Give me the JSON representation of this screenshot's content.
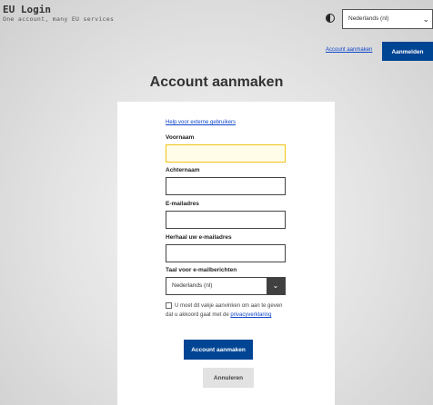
{
  "header": {
    "title": "EU Login",
    "subtitle": "One account, many EU services",
    "contrast_icon": "contrast-icon",
    "language": "Nederlands (nl)",
    "create_account_link": "Account aanmaken",
    "sign_in_button": "Aanmelden"
  },
  "main": {
    "title": "Account aanmaken",
    "help_link": "Help voor externe gebruikers",
    "fields": {
      "first_name_label": "Voornaam",
      "first_name_value": "",
      "last_name_label": "Achternaam",
      "last_name_value": "",
      "email_label": "E-mailadres",
      "email_value": "",
      "confirm_email_label": "Herhaal uw e-mailadres",
      "confirm_email_value": "",
      "email_language_label": "Taal voor e-mailberichten",
      "email_language_value": "Nederlands (nl)"
    },
    "consent_text": "U moet dit vakje aanvinken om aan te geven dat u akkoord gaat met de",
    "privacy_link": "privacyverklaring",
    "create_button": "Account aanmaken",
    "cancel_button": "Annuleren"
  },
  "colors": {
    "primary": "#004494",
    "link": "#0e47cb",
    "focus_border": "#f0c419"
  }
}
